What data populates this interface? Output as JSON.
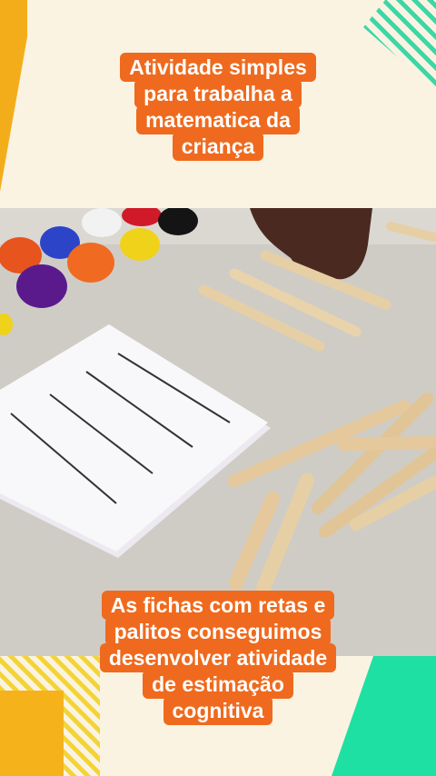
{
  "caption_top": {
    "lines": [
      "Atividade simples",
      "para trabalha a",
      "matematica da",
      "criança"
    ]
  },
  "caption_bottom": {
    "lines": [
      "As fichas com retas e",
      "palitos conseguimos",
      "desenvolver atividade",
      "de estimação",
      "cognitiva"
    ]
  },
  "colors": {
    "caption_bg": "#ef6a1e",
    "background": "#fbf3e2",
    "accent_yellow": "#f4ad1a",
    "accent_green": "#1ee0a3"
  }
}
